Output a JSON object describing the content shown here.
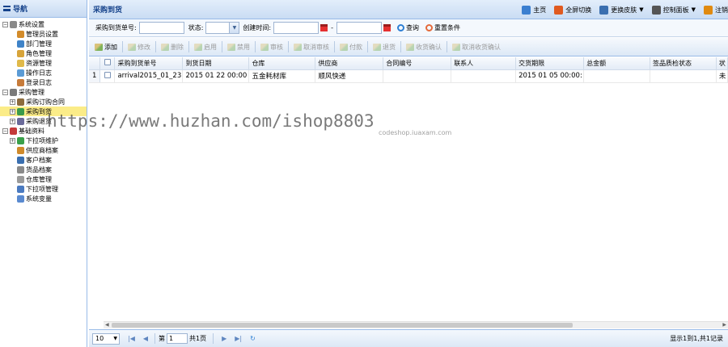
{
  "nav": {
    "title": "导航",
    "items": [
      {
        "label": "系统设置",
        "level": 0,
        "expander": "−",
        "icon_color": "#8a8a8a"
      },
      {
        "label": "管理员设置",
        "level": 1,
        "icon_color": "#d38b2a"
      },
      {
        "label": "部门管理",
        "level": 1,
        "icon_color": "#3f83c8"
      },
      {
        "label": "角色管理",
        "level": 1,
        "icon_color": "#d7a43a"
      },
      {
        "label": "资源管理",
        "level": 1,
        "icon_color": "#e0b94a"
      },
      {
        "label": "操作日志",
        "level": 1,
        "icon_color": "#5b9bd5"
      },
      {
        "label": "登录日志",
        "level": 1,
        "icon_color": "#c77b3a"
      },
      {
        "label": "采购管理",
        "level": 0,
        "expander": "−",
        "icon_color": "#7a7a7a"
      },
      {
        "label": "采购订购合同",
        "level": 1,
        "expander": "+",
        "icon_color": "#8c6b3c"
      },
      {
        "label": "采购到货",
        "level": 1,
        "expander": "+",
        "icon_color": "#3a9a4a",
        "selected": true
      },
      {
        "label": "采购退货",
        "level": 1,
        "expander": "+",
        "icon_color": "#6a6a9a"
      },
      {
        "label": "基础资料",
        "level": 0,
        "expander": "−",
        "icon_color": "#c43a3a"
      },
      {
        "label": "下拉项维护",
        "level": 1,
        "expander": "+",
        "icon_color": "#3aa04a"
      },
      {
        "label": "供应商档案",
        "level": 1,
        "icon_color": "#d08a2a"
      },
      {
        "label": "客户档案",
        "level": 1,
        "icon_color": "#3a6fb0"
      },
      {
        "label": "货品档案",
        "level": 1,
        "icon_color": "#8a8a8a"
      },
      {
        "label": "仓库管理",
        "level": 1,
        "icon_color": "#9a9a9a"
      },
      {
        "label": "下拉项管理",
        "level": 1,
        "icon_color": "#4a7ac0"
      },
      {
        "label": "系统变量",
        "level": 1,
        "icon_color": "#5a8ad0"
      }
    ]
  },
  "topbar": {
    "title": "采购到货",
    "links": [
      {
        "label": "主页",
        "icon": "home-icon",
        "color": "#3b7fd0",
        "caret": false
      },
      {
        "label": "全屏切换",
        "icon": "fullscreen-icon",
        "color": "#e05a20",
        "caret": false
      },
      {
        "label": "更换皮肤",
        "icon": "skin-icon",
        "color": "#3a6fb0",
        "caret": true
      },
      {
        "label": "控制面板",
        "icon": "control-panel-icon",
        "color": "#555555",
        "caret": true
      },
      {
        "label": "注销",
        "icon": "logout-icon",
        "color": "#e08a10",
        "caret": false
      }
    ]
  },
  "search": {
    "order_no_label": "采购到货单号:",
    "order_no_value": "",
    "status_label": "状态:",
    "status_value": "",
    "created_label": "创建时间:",
    "date_from": "",
    "date_sep": "-",
    "date_to": "",
    "query_label": "查询",
    "reset_label": "重置条件"
  },
  "toolbar": {
    "buttons": [
      {
        "label": "添加",
        "enabled": true
      },
      {
        "label": "修改",
        "enabled": false
      },
      {
        "label": "删除",
        "enabled": false
      },
      {
        "label": "启用",
        "enabled": false
      },
      {
        "label": "禁用",
        "enabled": false
      },
      {
        "label": "审核",
        "enabled": false
      },
      {
        "label": "取消审核",
        "enabled": false
      },
      {
        "label": "付款",
        "enabled": false
      },
      {
        "label": "退货",
        "enabled": false
      },
      {
        "label": "收货确认",
        "enabled": false
      },
      {
        "label": "取消收货确认",
        "enabled": false
      }
    ]
  },
  "grid": {
    "columns": [
      "采购到货单号",
      "到货日期",
      "仓库",
      "供应商",
      "合同编号",
      "联系人",
      "交货期限",
      "总金额",
      "签品质检状态",
      "状"
    ],
    "rows": [
      {
        "num": "1",
        "cells": [
          "arrival2015_01_23",
          "2015 01 22 00:00",
          "五金耗材库",
          "顺风快递",
          "",
          "",
          "2015 01 05 00:00:",
          "",
          "",
          "未"
        ]
      }
    ]
  },
  "pager": {
    "page_size": "10",
    "page_prefix": "第",
    "page_value": "1",
    "page_suffix": "共1页",
    "total_text": "显示1到1,共1记录"
  },
  "watermark": {
    "text": "https://www.huzhan.com/ishop8803",
    "subtext": "codeshop.iuaxam.com"
  }
}
